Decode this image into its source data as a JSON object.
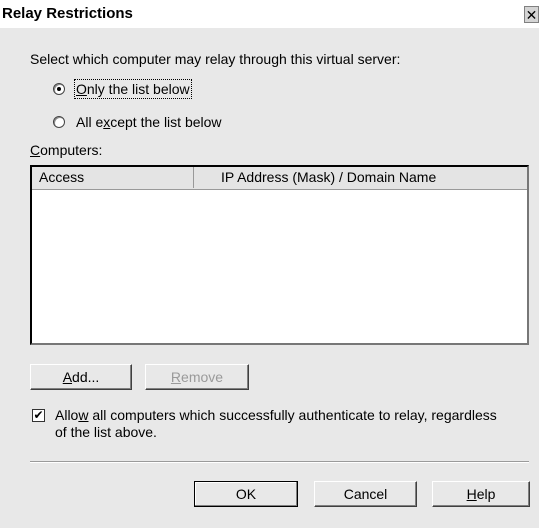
{
  "window": {
    "title": "Relay Restrictions",
    "close_glyph": "✕"
  },
  "prompt": "Select which computer may relay through this virtual server:",
  "radios": [
    {
      "label_pre": "",
      "label_key": "O",
      "label_post": "nly the list below",
      "checked": true
    },
    {
      "label_pre": "All e",
      "label_key": "x",
      "label_post": "cept the list below",
      "checked": false
    }
  ],
  "computers_label": {
    "key": "C",
    "rest": "omputers:"
  },
  "table": {
    "columns": [
      "Access",
      "IP Address (Mask) / Domain Name"
    ],
    "rows": []
  },
  "buttons": {
    "add": {
      "key": "A",
      "rest": "dd..."
    },
    "remove": {
      "key": "R",
      "rest": "emove",
      "disabled": true
    },
    "ok": "OK",
    "cancel": "Cancel",
    "help": {
      "key": "H",
      "rest": "elp"
    }
  },
  "auth_checkbox": {
    "checked": true,
    "check_glyph": "✔",
    "line1_pre": "Allo",
    "line1_key": "w",
    "line1_post": " all computers which successfully authenticate to relay, regardless",
    "line2": "of the list above."
  }
}
